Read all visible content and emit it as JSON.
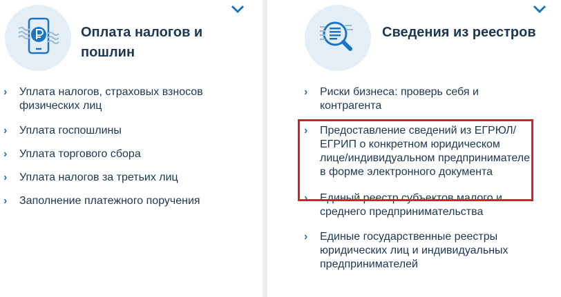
{
  "left_card": {
    "title": "Оплата налогов и пошлин",
    "icon": "phone-ruble-icon",
    "links": [
      "Уплата налогов, страховых взносов физических лиц",
      "Уплата госпошлины",
      "Уплата торгового сбора",
      "Уплата налогов за третьих лиц",
      "Заполнение платежного поручения"
    ]
  },
  "right_card": {
    "title": "Сведения из реестров",
    "icon": "registry-search-icon",
    "links": [
      "Риски бизнеса: проверь себя и контрагента",
      "Предоставление сведений из ЕГРЮЛ/ЕГРИП о конкретном юридическом лице/индивидуальном предпринимателе в форме электронного документа",
      "Единый реестр субъектов малого и среднего предпринимательства",
      "Единые государственные реестры юридических лиц и индивидуальных предпринимателей"
    ]
  },
  "icons": {
    "expand": "chevron-down-icon",
    "link_arrow": "chevron-right-icon"
  },
  "colors": {
    "accent": "#1a74c4",
    "title_text": "#1d3752",
    "highlight": "#d6202a",
    "icon_bg": "#e4eef7"
  }
}
